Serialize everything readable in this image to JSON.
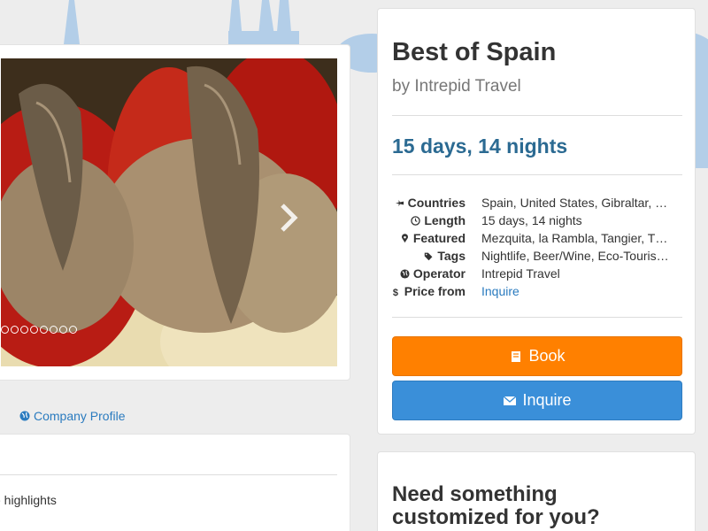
{
  "gallery": {
    "slide_count": 8
  },
  "links": {
    "company_profile": "Company Profile"
  },
  "highlights": {
    "text": "e highlights"
  },
  "trip": {
    "title": "Best of Spain",
    "byline": "by Intrepid Travel",
    "duration": "15 days, 14 nights"
  },
  "details": {
    "countries_label": "Countries",
    "countries_value": "Spain, United States, Gibraltar, …",
    "length_label": "Length",
    "length_value": "15 days, 14 nights",
    "featured_label": "Featured",
    "featured_value": "Mezquita, la Rambla, Tangier, T…",
    "tags_label": "Tags",
    "tags_value": "Nightlife, Beer/Wine, Eco-Touris…",
    "operator_label": "Operator",
    "operator_value": "Intrepid Travel",
    "price_label": "Price from",
    "price_value": "Inquire"
  },
  "buttons": {
    "book": "Book",
    "inquire": "Inquire"
  },
  "custom": {
    "heading": "Need something customized for you?"
  },
  "colors": {
    "accent_blue": "#2b6a92",
    "link_blue": "#2a7bbf",
    "book_orange": "#ff8000",
    "inquire_blue": "#3a8fd9",
    "skyline_blue": "#a9c9e8"
  },
  "icons": {
    "countries": "plane-icon",
    "length": "clock-icon",
    "featured": "map-marker-icon",
    "tags": "tags-icon",
    "operator": "globe-icon",
    "price": "dollar-icon",
    "book": "book-icon",
    "inquire": "envelope-icon",
    "company": "globe-icon",
    "next": "chevron-right-icon"
  }
}
